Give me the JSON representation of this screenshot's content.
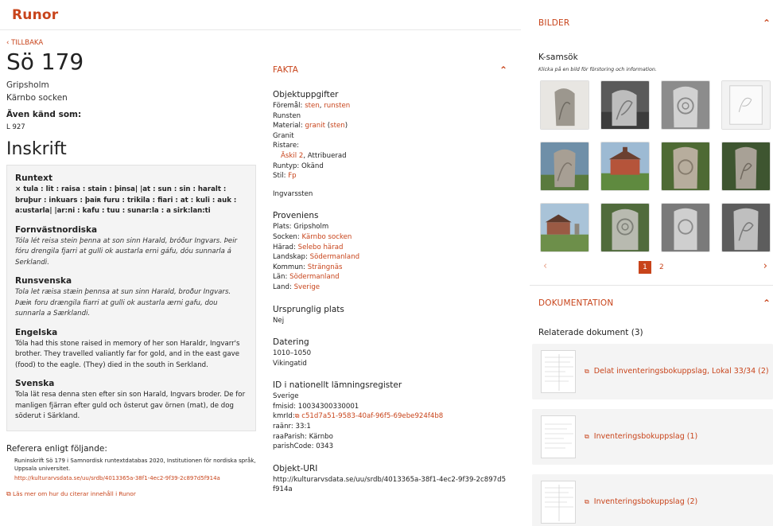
{
  "site": {
    "logo": "Runor"
  },
  "back_link": "‹ TILLBAKA",
  "object": {
    "title": "Sö 179",
    "place": "Gripsholm",
    "parish": "Kärnbo socken",
    "aka_label": "Även känd som:",
    "aka_value": "L 927"
  },
  "inskrift": {
    "heading": "Inskrift",
    "blocks": [
      {
        "title": "Runtext",
        "text": "× tula : lit : raisa : stain : þinsa| |at : sun : sin : haralt : bruþur : inkuars : þaiʀ furu : trikila : fiari : at : kuli : auk : a:ustarla| |ar:ni : kafu : tuu : sunar:la : a sirk:lan:ti"
      },
      {
        "title": "Fornvästnordiska",
        "text": "Tóla lét reisa stein þenna at son sinn Harald, bróður Ingvars. Þeir fóru drengila fjarri at gulli ok austarla erni gáfu, dóu sunnarla á Serklandi."
      },
      {
        "title": "Runsvenska",
        "text": "Tola let ræisa stæin þennsa at sun sinn Harald, broður Ingvars. Þæiʀ foru drængila fiarri at gulli ok austarla ærni gafu, dou sunnarla a Særklandi."
      },
      {
        "title": "Engelska",
        "text": "Tóla had this stone raised in memory of her son Haraldr, Ingvarr's brother. They travelled valiantly far for gold, and in the east gave (food) to the eagle. (They) died in the south in Serkland."
      },
      {
        "title": "Svenska",
        "text": "Tola lät resa denna sten efter sin son Harald, Ingvars broder. De for manligen fjärran efter guld och österut gav örnen (mat), de dog söderut i Särkland."
      }
    ]
  },
  "cite": {
    "heading": "Referera enligt följande:",
    "text": "Runinskrift Sö 179 i Samnordisk runtextdatabas 2020, Institutionen för nordiska språk, Uppsala universitet.",
    "url": "http://kulturarvsdata.se/uu/srdb/4013365a-38f1-4ec2-9f39-2c897d5f914a",
    "more": "Läs mer om hur du citerar innehåll i Runor"
  },
  "fakta": {
    "title": "FAKTA",
    "objektuppgifter": {
      "heading": "Objektuppgifter",
      "foremal_label": "Föremål:",
      "foremal_v1": "sten",
      "foremal_sep": ",",
      "foremal_v2": "runsten",
      "runsten": "Runsten",
      "material_label": "Material:",
      "material_v1": "granit",
      "material_v2": "sten",
      "granit": "Granit",
      "ristare_label": "Ristare:",
      "ristare_link": "Äskil 2",
      "ristare_rest": ", Attribuerad",
      "runtyp": "Runtyp: Okänd",
      "stil_label": "Stil:",
      "stil_value": "Fp",
      "ingvarssten": "Ingvarssten"
    },
    "proveniens": {
      "heading": "Proveniens",
      "plats": "Plats: Gripsholm",
      "socken_label": "Socken:",
      "socken_value": "Kärnbo socken",
      "harad_label": "Härad:",
      "harad_value": "Selebo härad",
      "landskap_label": "Landskap:",
      "landskap_value": "Södermanland",
      "kommun_label": "Kommun:",
      "kommun_value": "Strängnäs",
      "lan_label": "Län:",
      "lan_value": "Södermanland",
      "land_label": "Land:",
      "land_value": "Sverige"
    },
    "ursprunglig": {
      "heading": "Ursprunglig plats",
      "value": "Nej"
    },
    "datering": {
      "heading": "Datering",
      "value": "1010–1050",
      "period": "Vikingatid"
    },
    "id": {
      "heading": "ID i nationellt lämningsregister",
      "land": "Sverige",
      "fmisid": "fmisid: 10034300330001",
      "kmrid_label": "kmrId:",
      "kmrid_value": "c51d7a51-9583-40af-96f5-69ebe924f4b8",
      "raanr": "raänr: 33:1",
      "raaparish": "raaParish: Kärnbo",
      "parishcode": "parishCode: 0343"
    },
    "uri": {
      "heading": "Objekt-URI",
      "value": "http://kulturarvsdata.se/uu/srdb/4013365a-38f1-4ec2-9f39-2c897d5f914a"
    }
  },
  "bilder": {
    "title": "BILDER",
    "collection_title": "K-samsök",
    "hint": "Klicka på en bild för förstoring och information.",
    "pages": [
      "1",
      "2"
    ]
  },
  "dokumentation": {
    "title": "DOKUMENTATION",
    "related_heading": "Relaterade dokument (3)",
    "docs": [
      "Delat inventeringsbokuppslag, Lokal 33/34 (2)",
      "Inventeringsbokuppslag (1)",
      "Inventeringsbokuppslag (2)"
    ]
  },
  "colors": {
    "accent": "#c8441b",
    "panel_bg": "#f4f4f4"
  },
  "icons": {
    "external_link": "external-link-icon",
    "chevron_up": "chevron-up-icon",
    "prev": "chevron-left-icon",
    "next": "chevron-right-icon"
  }
}
